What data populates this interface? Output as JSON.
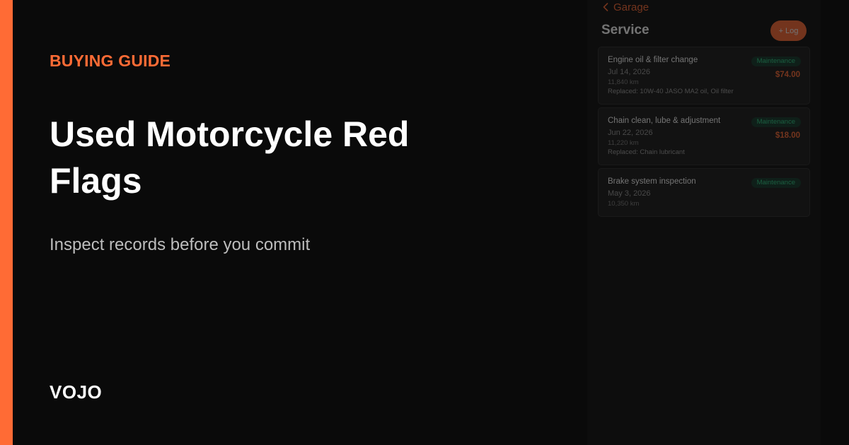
{
  "hero": {
    "eyebrow": "BUYING GUIDE",
    "title": "Used Motorcycle Red Flags",
    "subtitle": "Inspect records before you commit",
    "brand": "VOJO"
  },
  "app": {
    "back_label": "Garage",
    "screen_title": "Service",
    "add_button_label": "+ Log",
    "records": [
      {
        "title": "Engine oil & filter change",
        "category": "Maintenance",
        "date": "Jul 14, 2026",
        "odometer": "11,840 km",
        "parts": "Replaced: 10W-40 JASO MA2 oil, Oil filter",
        "cost": "$74.00"
      },
      {
        "title": "Chain clean, lube & adjustment",
        "category": "Maintenance",
        "date": "Jun 22, 2026",
        "odometer": "11,220 km",
        "parts": "Replaced: Chain lubricant",
        "cost": "$18.00"
      },
      {
        "title": "Brake system inspection",
        "category": "Maintenance",
        "date": "May 3, 2026",
        "odometer": "10,350 km"
      }
    ]
  },
  "colors": {
    "accent": "#ff6b35",
    "background": "#0a0a0a",
    "badge_text": "#2ecf87",
    "badge_bg": "#13382a"
  }
}
